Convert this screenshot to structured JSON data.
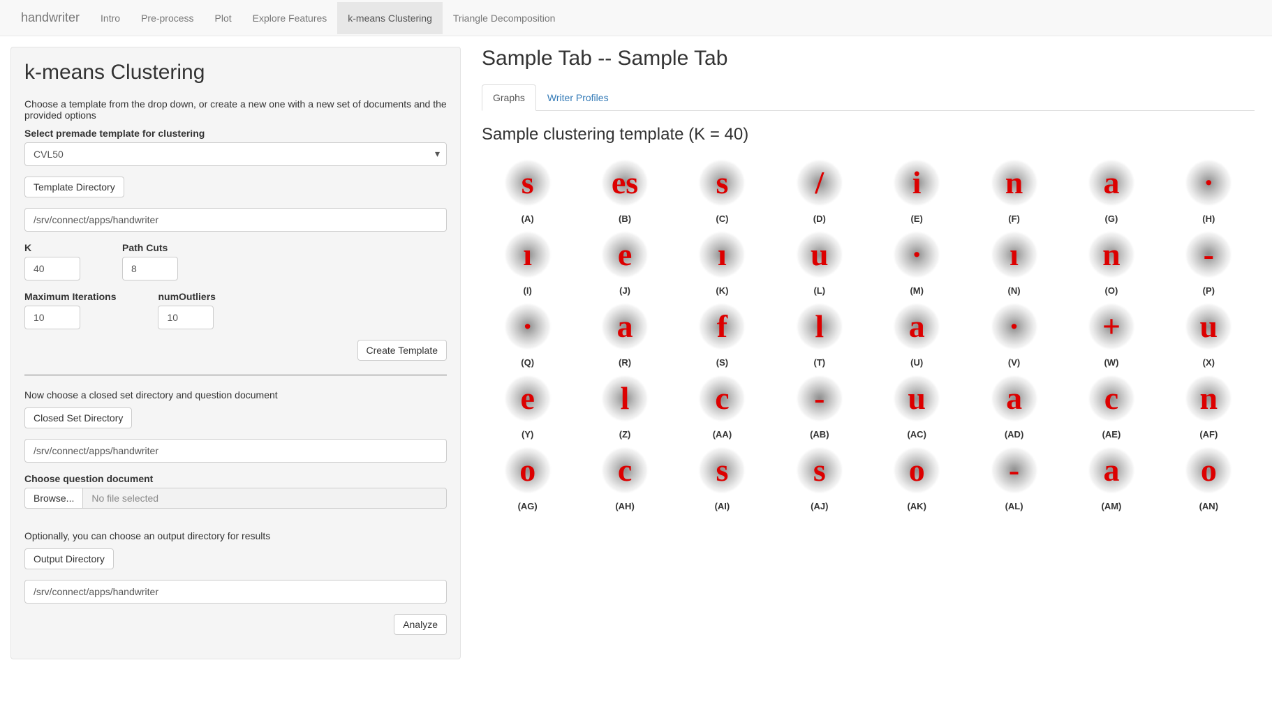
{
  "navbar": {
    "brand": "handwriter",
    "items": [
      "Intro",
      "Pre-process",
      "Plot",
      "Explore Features",
      "k-means Clustering",
      "Triangle Decomposition"
    ],
    "active_index": 4
  },
  "left": {
    "title": "k-means Clustering",
    "intro_text": "Choose a template from the drop down, or create a new one with a new set of documents and the provided options",
    "select_template_label": "Select premade template for clustering",
    "template_value": "CVL50",
    "template_dir_button": "Template Directory",
    "template_dir_value": "/srv/connect/apps/handwriter",
    "k_label": "K",
    "k_value": "40",
    "pathcuts_label": "Path Cuts",
    "pathcuts_value": "8",
    "maxiter_label": "Maximum Iterations",
    "maxiter_value": "10",
    "numoutliers_label": "numOutliers",
    "numoutliers_value": "10",
    "create_template_button": "Create Template",
    "closed_set_text": "Now choose a closed set directory and question document",
    "closed_set_button": "Closed Set Directory",
    "closed_set_value": "/srv/connect/apps/handwriter",
    "question_doc_label": "Choose question document",
    "browse_button": "Browse...",
    "no_file_text": "No file selected",
    "output_text": "Optionally, you can choose an output directory for results",
    "output_dir_button": "Output Directory",
    "output_dir_value": "/srv/connect/apps/handwriter",
    "analyze_button": "Analyze"
  },
  "right": {
    "title": "Sample Tab -- Sample Tab",
    "tabs": [
      "Graphs",
      "Writer Profiles"
    ],
    "active_tab_index": 0,
    "subtitle": "Sample clustering template (K = 40)",
    "clusters": [
      {
        "label": "(A)",
        "glyph": "s"
      },
      {
        "label": "(B)",
        "glyph": "es"
      },
      {
        "label": "(C)",
        "glyph": "s"
      },
      {
        "label": "(D)",
        "glyph": "/"
      },
      {
        "label": "(E)",
        "glyph": "i"
      },
      {
        "label": "(F)",
        "glyph": "n"
      },
      {
        "label": "(G)",
        "glyph": "a"
      },
      {
        "label": "(H)",
        "glyph": "·"
      },
      {
        "label": "(I)",
        "glyph": "ı"
      },
      {
        "label": "(J)",
        "glyph": "e"
      },
      {
        "label": "(K)",
        "glyph": "ı"
      },
      {
        "label": "(L)",
        "glyph": "u"
      },
      {
        "label": "(M)",
        "glyph": "·"
      },
      {
        "label": "(N)",
        "glyph": "ı"
      },
      {
        "label": "(O)",
        "glyph": "n"
      },
      {
        "label": "(P)",
        "glyph": "-"
      },
      {
        "label": "(Q)",
        "glyph": "·"
      },
      {
        "label": "(R)",
        "glyph": "a"
      },
      {
        "label": "(S)",
        "glyph": "f"
      },
      {
        "label": "(T)",
        "glyph": "l"
      },
      {
        "label": "(U)",
        "glyph": "a"
      },
      {
        "label": "(V)",
        "glyph": "·"
      },
      {
        "label": "(W)",
        "glyph": "+"
      },
      {
        "label": "(X)",
        "glyph": "u"
      },
      {
        "label": "(Y)",
        "glyph": "e"
      },
      {
        "label": "(Z)",
        "glyph": "l"
      },
      {
        "label": "(AA)",
        "glyph": "c"
      },
      {
        "label": "(AB)",
        "glyph": "-"
      },
      {
        "label": "(AC)",
        "glyph": "u"
      },
      {
        "label": "(AD)",
        "glyph": "a"
      },
      {
        "label": "(AE)",
        "glyph": "c"
      },
      {
        "label": "(AF)",
        "glyph": "n"
      },
      {
        "label": "(AG)",
        "glyph": "o"
      },
      {
        "label": "(AH)",
        "glyph": "c"
      },
      {
        "label": "(AI)",
        "glyph": "s"
      },
      {
        "label": "(AJ)",
        "glyph": "s"
      },
      {
        "label": "(AK)",
        "glyph": "o"
      },
      {
        "label": "(AL)",
        "glyph": "-"
      },
      {
        "label": "(AM)",
        "glyph": "a"
      },
      {
        "label": "(AN)",
        "glyph": "o"
      }
    ]
  }
}
